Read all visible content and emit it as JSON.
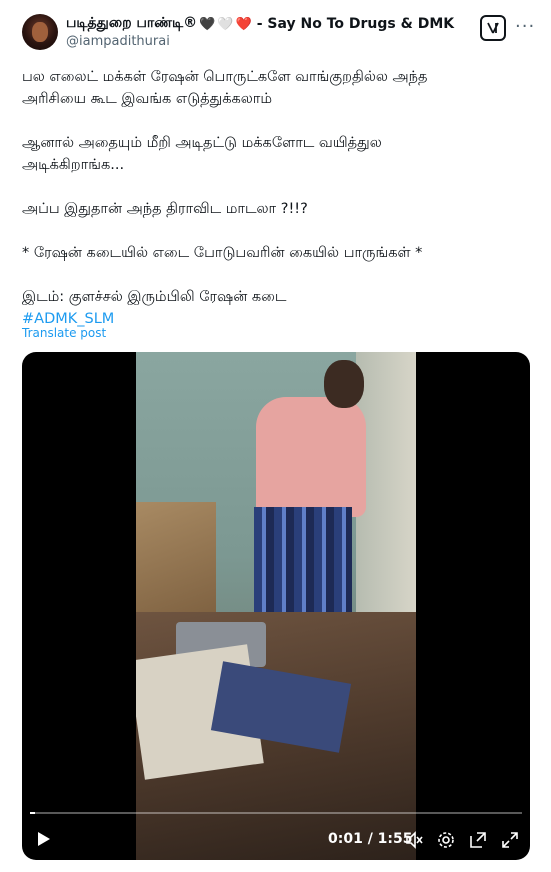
{
  "author": {
    "display_name": "படித்துறை பாண்டி®",
    "hearts": [
      "🖤",
      "🤍",
      "❤️"
    ],
    "tagline": "- Say No To Drugs & DMK",
    "handle": "@iampadithurai"
  },
  "tweet": {
    "lines": [
      "பல எலைட் மக்கள் ரேஷன் பொருட்களே வாங்குறதில்ல அந்த",
      "அரிசியை கூட இவங்க எடுத்துக்கலாம்",
      "",
      "ஆனால் அதையும் மீறி அடிதட்டு மக்களோட வயித்துல",
      "அடிக்கிறாங்க...",
      "",
      "அப்ப இதுதான் அந்த திராவிட மாடலா ?!!?",
      "",
      "* ரேஷன் கடையில் எடை போடுபவரின் கையில் பாருங்கள் *",
      "",
      "இடம்: குளச்சல் இரும்பிலி ரேஷன் கடை"
    ],
    "hashtag": "#ADMK_SLM",
    "translate_label": "Translate post"
  },
  "video": {
    "time": "0:01 / 1:55",
    "progress": 0.01
  },
  "icons": {
    "header": [
      "grok-icon",
      "more-icon"
    ],
    "controls": [
      "play-icon",
      "mute-icon",
      "settings-icon",
      "pip-icon",
      "fullscreen-icon"
    ]
  },
  "colors": {
    "accent": "#1d9bf0",
    "text": "#0f1419",
    "secondary": "#536471"
  }
}
